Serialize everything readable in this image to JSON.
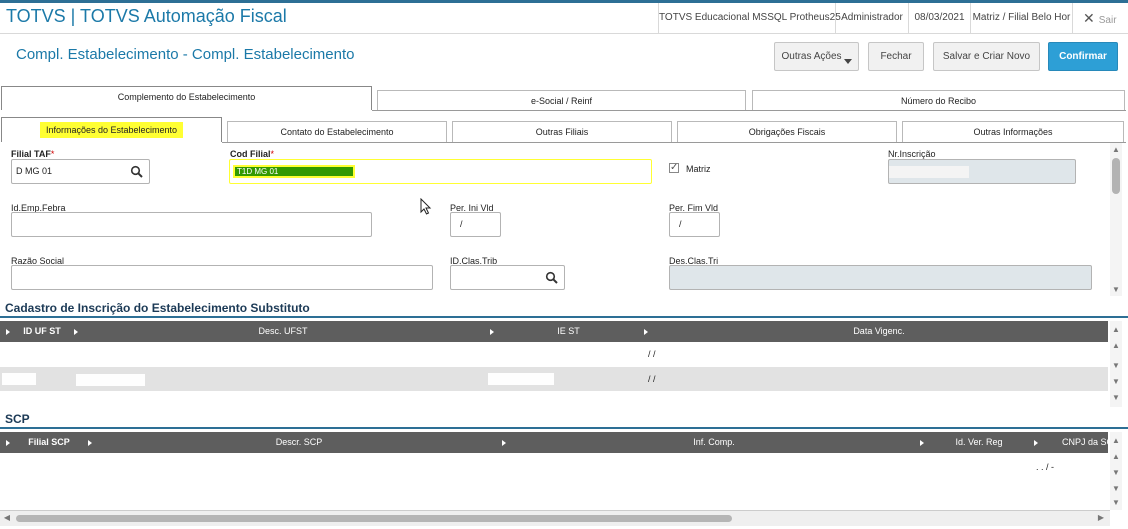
{
  "app": {
    "title": "TOTVS | TOTVS Automação Fiscal",
    "environment": "TOTVS Educacional MSSQL Protheus25",
    "user": "Administrador",
    "date": "08/03/2021",
    "branch": "Matriz / Filial Belo Hor",
    "exit_label": "Sair"
  },
  "header": {
    "title": "Compl. Estabelecimento - Compl. Estabelecimento",
    "buttons": {
      "other_actions": "Outras Ações",
      "close": "Fechar",
      "save_new": "Salvar e Criar Novo",
      "confirm": "Confirmar"
    }
  },
  "tabs_top": [
    "Complemento do Estabelecimento",
    "e-Social / Reinf",
    "Número do Recibo"
  ],
  "tabs_sub": [
    "Informações do Estabelecimento",
    "Contato do Estabelecimento",
    "Outras Filiais",
    "Obrigações Fiscais",
    "Outras Informações"
  ],
  "form": {
    "filial_taf": {
      "label": "Filial TAF",
      "value": "D MG 01"
    },
    "cod_filial": {
      "label": "Cod Filial",
      "value": "T1D MG 01"
    },
    "matriz": {
      "label": "Matriz",
      "checked": true
    },
    "nr_inscricao": {
      "label": "Nr.Inscrição",
      "value": ""
    },
    "id_emp_febra": {
      "label": "Id.Emp.Febra",
      "value": ""
    },
    "per_ini_vld": {
      "label": "Per. Ini Vld",
      "value": "/"
    },
    "per_fim_vld": {
      "label": "Per. Fim Vld",
      "value": "/"
    },
    "razao_social": {
      "label": "Razão Social",
      "value": ""
    },
    "id_clas_trib": {
      "label": "ID.Clas.Trib",
      "value": ""
    },
    "des_clas_tri": {
      "label": "Des.Clas.Tri",
      "value": ""
    }
  },
  "section1": {
    "title": "Cadastro de Inscrição do Estabelecimento Substituto",
    "columns": [
      "ID UF ST",
      "Desc. UFST",
      "IE ST",
      "Data Vigenc."
    ],
    "rows": [
      {
        "data_vigenc": "/ /"
      },
      {
        "data_vigenc": "/ /"
      }
    ]
  },
  "section2": {
    "title": "SCP",
    "columns": [
      "Filial SCP",
      "Descr. SCP",
      "Inf. Comp.",
      "Id. Ver. Reg",
      "CNPJ da SC"
    ],
    "rows": [
      {
        "cnpj": ". . / -"
      }
    ]
  },
  "icons": [
    "search-icon",
    "close-icon",
    "chevron-down-icon",
    "check-icon",
    "arrow-up-icon",
    "arrow-down-icon",
    "arrow-left-icon",
    "arrow-right-icon"
  ],
  "colors": {
    "brand": "#1b79a8",
    "confirm": "#2d9fd6",
    "highlight": "#ffff33",
    "grid_header": "#5e5e5e"
  }
}
